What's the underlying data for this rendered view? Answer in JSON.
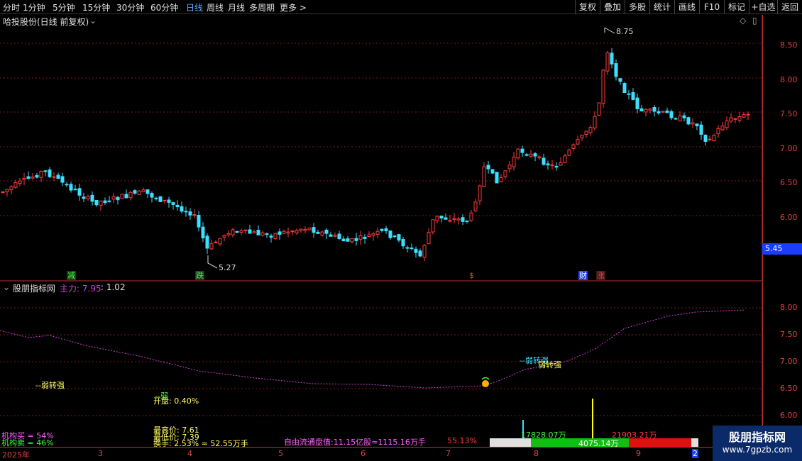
{
  "toolbar": {
    "periods": [
      "分时",
      "1分钟",
      "5分钟",
      "15分钟",
      "30分钟",
      "60分钟",
      "日线",
      "周线",
      "月线",
      "多周期",
      "更多 >"
    ],
    "active_period": "日线",
    "buttons": [
      "复权",
      "叠加",
      "多股",
      "统计",
      "画线",
      "F10",
      "标记",
      "+自选",
      "返回"
    ]
  },
  "price_pane": {
    "title": "哈投股份(日线 前复权)",
    "axis": [
      "8.50",
      "8.00",
      "7.50",
      "7.00",
      "6.50",
      "6.00"
    ],
    "current_price": "5.45",
    "high_label": "8.75",
    "low_label": "5.27",
    "tags": [
      "减",
      "跌",
      "$",
      "财",
      "涨"
    ],
    "colors": {
      "up": "#ff3c3c",
      "down": "#3ce0ff",
      "grid": "#7a1a1a"
    }
  },
  "indicator_pane": {
    "title": "股朋指标网",
    "main_force_label": "主力: 7.95",
    "ratio_label": ": 1.02",
    "axis": [
      "8.00",
      "7.50",
      "7.00",
      "6.50",
      "6.00"
    ],
    "signals": {
      "weak_to_strong_1": "--弱转强",
      "weak_to_strong_2": "--弱转强",
      "weak_to_strong_3": "弱转强",
      "weak": "--弱",
      "open": "开盘: 0.40%"
    }
  },
  "stats": {
    "inst_buy": "机构买 = 54%",
    "inst_sell": "机构卖 = 46%",
    "high": "最高价: 7.61",
    "low": "最低价: 7.39",
    "turnover": "换手: 2.53% ≈ 52.55万手",
    "float_cap": "自由流通盘值:11.15亿股≈1115.16万手",
    "pct": "55.13%",
    "vol_left": "17828.07万",
    "vol_mid": "4075.14万",
    "vol_right": "21903.21万"
  },
  "timeline": {
    "months": [
      "2025年",
      "3",
      "4",
      "5",
      "6",
      "7",
      "8",
      "9",
      "2"
    ]
  },
  "logo": {
    "line1": "股朋指标网",
    "line2": "www.7gpzb.com"
  }
}
